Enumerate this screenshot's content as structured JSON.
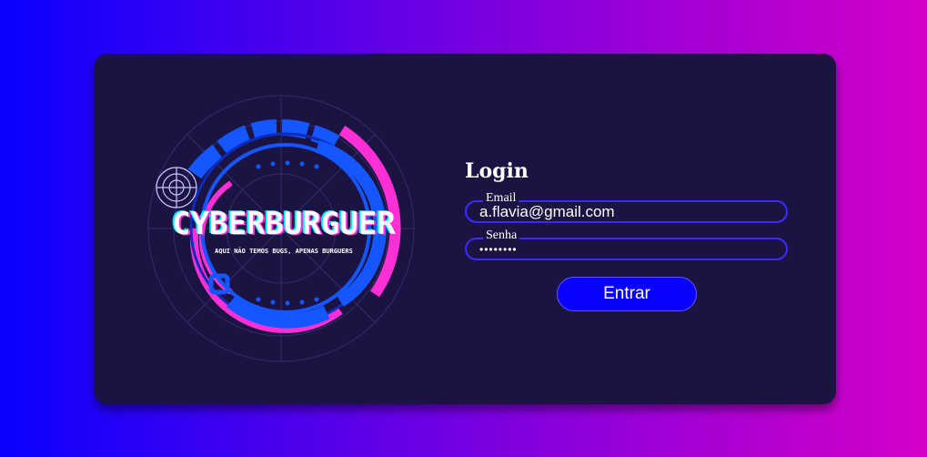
{
  "logo": {
    "brand": "CYBERBURGUER",
    "tagline": "AQUI NÃO TEMOS BUGS, APENAS BURGUERS"
  },
  "login": {
    "title": "Login",
    "email_label": "Email",
    "email_value": "a.flavia@gmail.com",
    "password_label": "Senha",
    "password_value": "flavia12",
    "submit_label": "Entrar"
  },
  "colors": {
    "background_start": "#0a00ff",
    "background_end": "#d400c8",
    "card": "#1b1442",
    "accent_blue": "#0a00ff",
    "accent_pink": "#ff2fd6",
    "accent_cyan": "#00e5ff"
  }
}
